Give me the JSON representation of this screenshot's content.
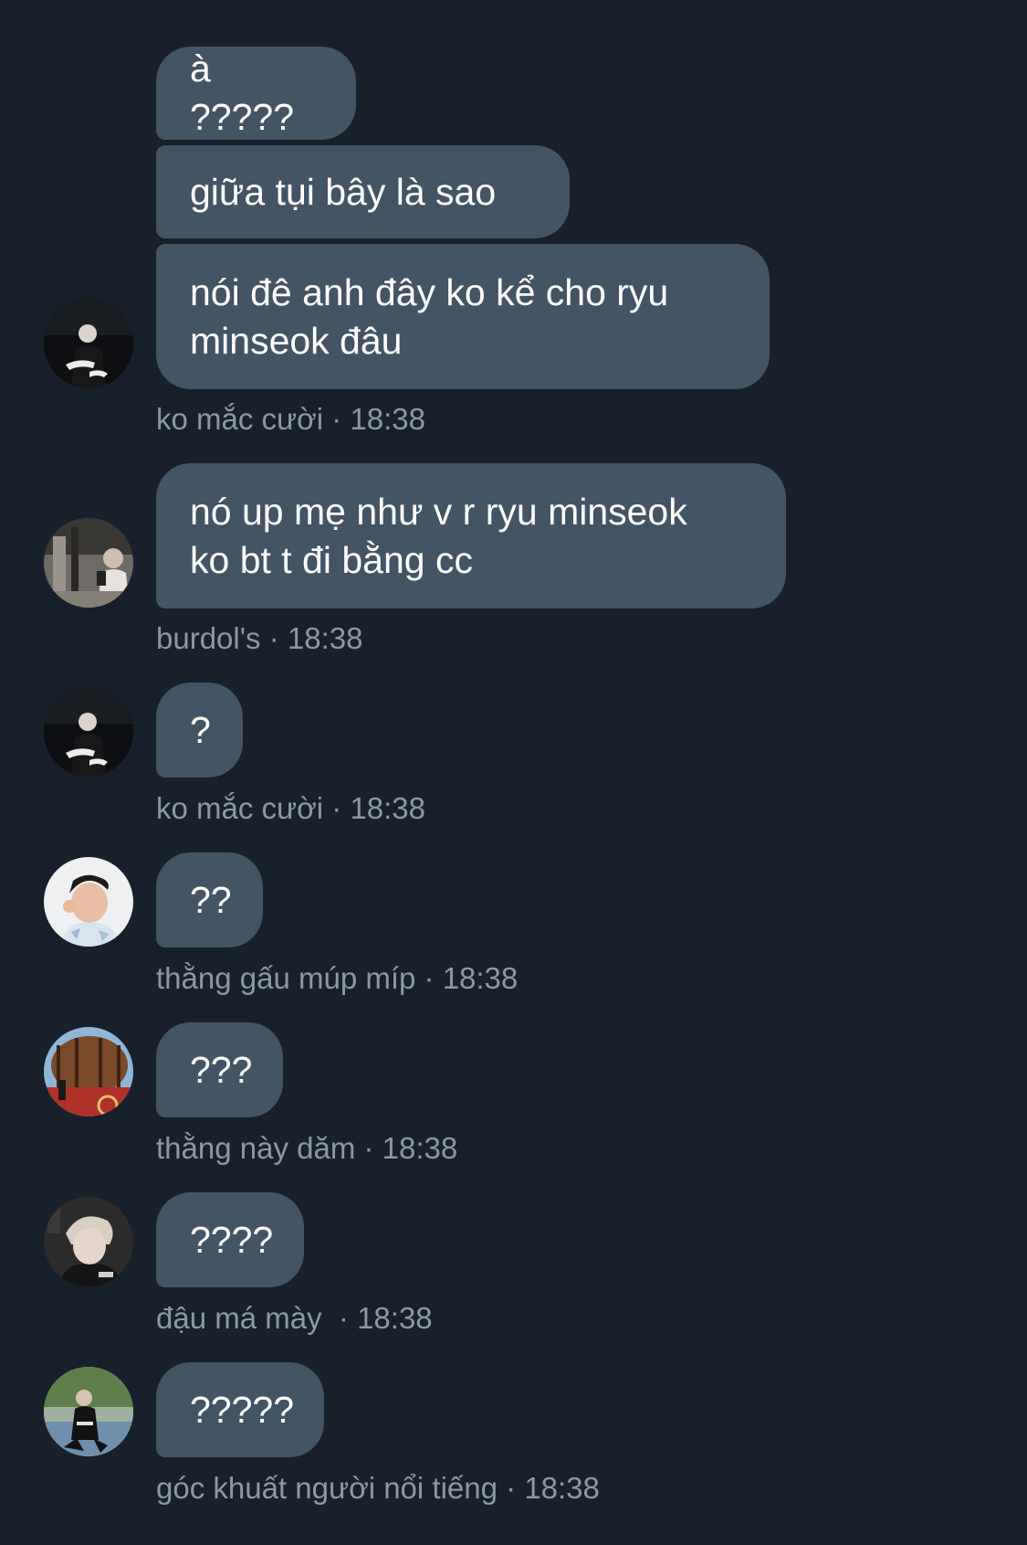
{
  "messages": [
    {
      "sender": "ko mắc cười",
      "time": "18:38",
      "separator": " · ",
      "bubbles": [
        "à ?????",
        "giữa tụi bây là sao",
        "nói đê anh đây ko kể cho ryu\nminseok đâu"
      ],
      "avatar_icon": "person-dark-night-photo"
    },
    {
      "sender": "burdol's",
      "time": "18:38",
      "separator": " · ",
      "bubbles": [
        "nó up mẹ như v r ryu minseok\nko bt t đi bằng cc"
      ],
      "avatar_icon": "person-mirror-selfie-photo"
    },
    {
      "sender": "ko mắc cười",
      "time": "18:38",
      "separator": " · ",
      "bubbles": [
        "?"
      ],
      "avatar_icon": "person-dark-night-photo"
    },
    {
      "sender": "thằng gấu múp míp",
      "time": "18:38",
      "separator": " · ",
      "bubbles": [
        "??"
      ],
      "avatar_icon": "child-portrait-photo"
    },
    {
      "sender": "thằng này dăm",
      "time": "18:38",
      "separator": " · ",
      "bubbles": [
        "???"
      ],
      "avatar_icon": "wine-barrel-photo"
    },
    {
      "sender": "đậu má mày ",
      "time": "18:38",
      "separator": " · ",
      "bubbles": [
        "????"
      ],
      "avatar_icon": "person-blonde-selfie-photo"
    },
    {
      "sender": "góc khuất người nổi tiếng",
      "time": "18:38",
      "separator": " · ",
      "bubbles": [
        "?????"
      ],
      "avatar_icon": "person-outdoor-court-photo"
    }
  ],
  "colors": {
    "background": "#17202b",
    "bubble": "#435464",
    "bubble_text": "#ffffff",
    "meta_text": "#8b98a5"
  }
}
